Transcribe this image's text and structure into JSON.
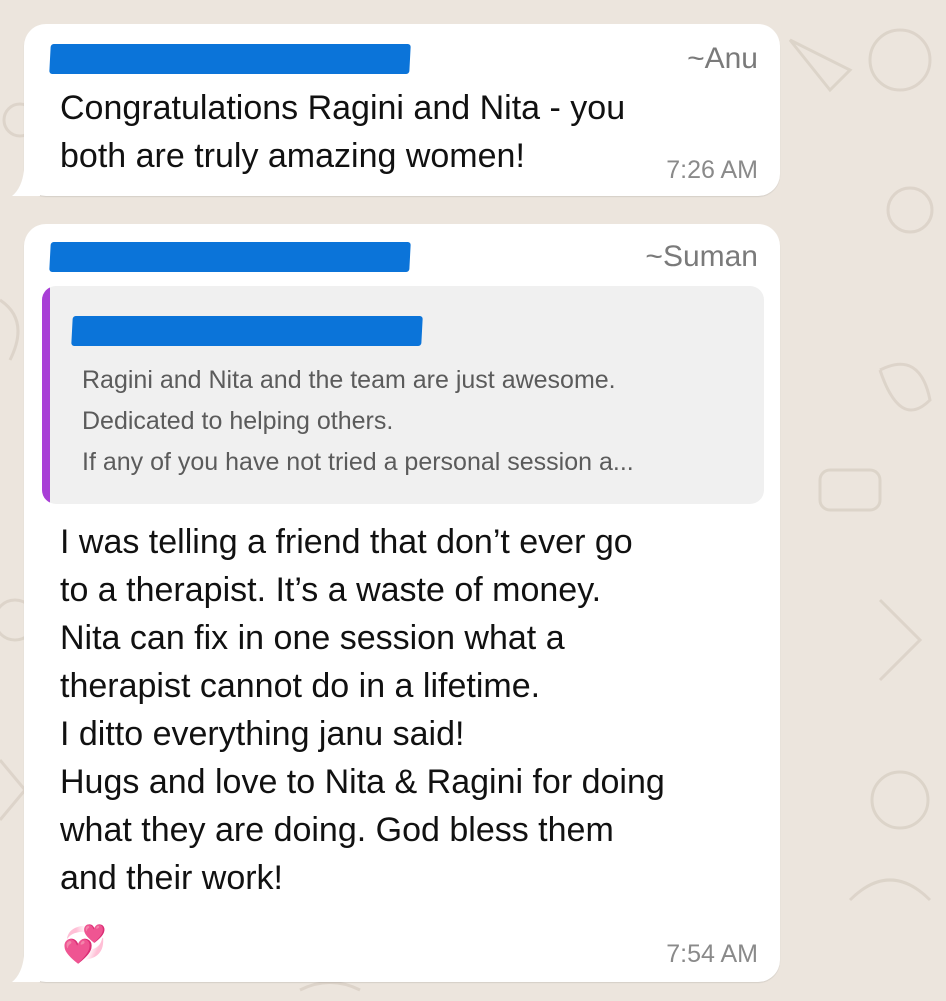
{
  "colors": {
    "background": "#ece5dd",
    "bubble": "#ffffff",
    "redaction": "#0b74d9",
    "quote_bar": "#a83fd6",
    "quote_bg": "#f0f0f0",
    "meta_text": "#8a8a8a"
  },
  "messages": [
    {
      "sender": "~Anu",
      "text": "Congratulations Ragini and Nita - you\nboth are truly amazing women!",
      "time": "7:26 AM"
    },
    {
      "sender": "~Suman",
      "quote": {
        "text": "Ragini and Nita and the team are just awesome.\nDedicated to helping others.\nIf any of you have not tried a personal session a..."
      },
      "text": "I was telling a friend that don’t ever go\nto a therapist. It’s a waste of money.\nNita can fix in one session what a\ntherapist cannot do in a lifetime.\nI ditto everything janu said!\nHugs and love to Nita & Ragini for doing\nwhat they are doing. God bless them\nand their work!",
      "emoji": "💞",
      "time": "7:54 AM"
    }
  ]
}
